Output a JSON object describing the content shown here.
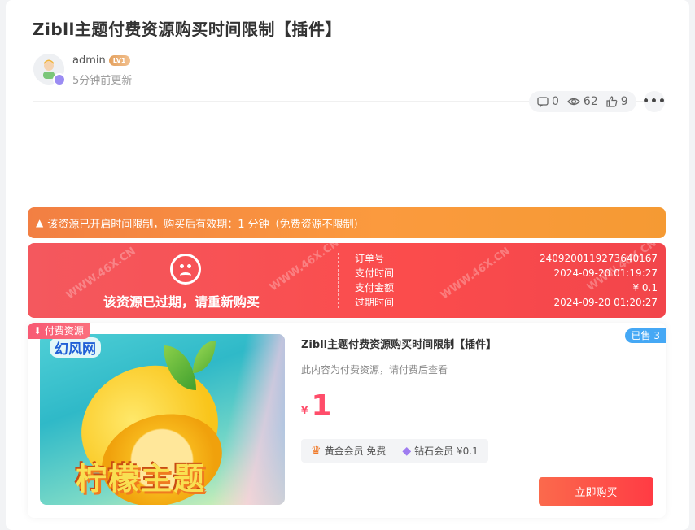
{
  "post": {
    "title": "Zibll主题付费资源购买时间限制【插件】",
    "author": "admin",
    "level": "LV1",
    "updated": "5分钟前更新",
    "stats": {
      "comments": "0",
      "views": "62",
      "likes": "9"
    }
  },
  "notice": {
    "text": "该资源已开启时间限制，购买后有效期：1 分钟（免费资源不限制）"
  },
  "expired": {
    "message": "该资源已过期，请重新购买",
    "rows": [
      {
        "label": "订单号",
        "value": "240920011927364016​7"
      },
      {
        "label": "支付时间",
        "value": "2024-09-20 01:19:27"
      },
      {
        "label": "支付金额",
        "value": "¥ 0.1"
      },
      {
        "label": "过期时间",
        "value": "2024-09-20 01:20:27"
      }
    ]
  },
  "product": {
    "tag": "付费资源",
    "sold": "已售 3",
    "logo": "幻风网",
    "cover_title": "柠檬主题",
    "title": "Zibll主题付费资源购买时间限制【插件】",
    "desc": "此内容为付费资源，请付费后查看",
    "currency": "¥",
    "price": "1",
    "vip": [
      {
        "icon": "crown-icon",
        "text": "黄金会员 免费"
      },
      {
        "icon": "diamond-icon",
        "text": "钻石会员 ¥0.1"
      }
    ],
    "buy_label": "立即购买"
  },
  "colors": {
    "accent": "#ff4d6a",
    "notice": "#f58a3c",
    "expired": "#f6504f",
    "sold": "#45a8f5"
  }
}
